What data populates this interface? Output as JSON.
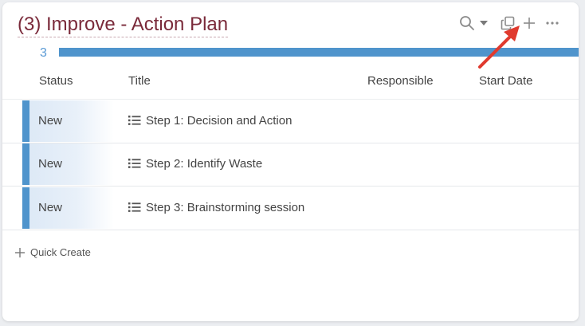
{
  "widget": {
    "title": "(3) Improve - Action Plan",
    "count": "3",
    "accent_color": "#4f94cc",
    "title_color": "#7a2a3a"
  },
  "toolbar": {
    "icons": [
      "search-icon",
      "dropdown-caret-icon",
      "copy-icon",
      "plus-icon",
      "more-icon"
    ]
  },
  "table": {
    "columns": [
      "Status",
      "Title",
      "Responsible",
      "Start Date"
    ],
    "rows": [
      {
        "status": "New",
        "title": "Step 1: Decision and Action",
        "responsible": "",
        "start_date": ""
      },
      {
        "status": "New",
        "title": "Step 2: Identify Waste",
        "responsible": "",
        "start_date": ""
      },
      {
        "status": "New",
        "title": "Step 3: Brainstorming session",
        "responsible": "",
        "start_date": ""
      }
    ]
  },
  "quick_create": {
    "label": "Quick Create"
  },
  "annotation": {
    "color": "#e03a2e"
  }
}
